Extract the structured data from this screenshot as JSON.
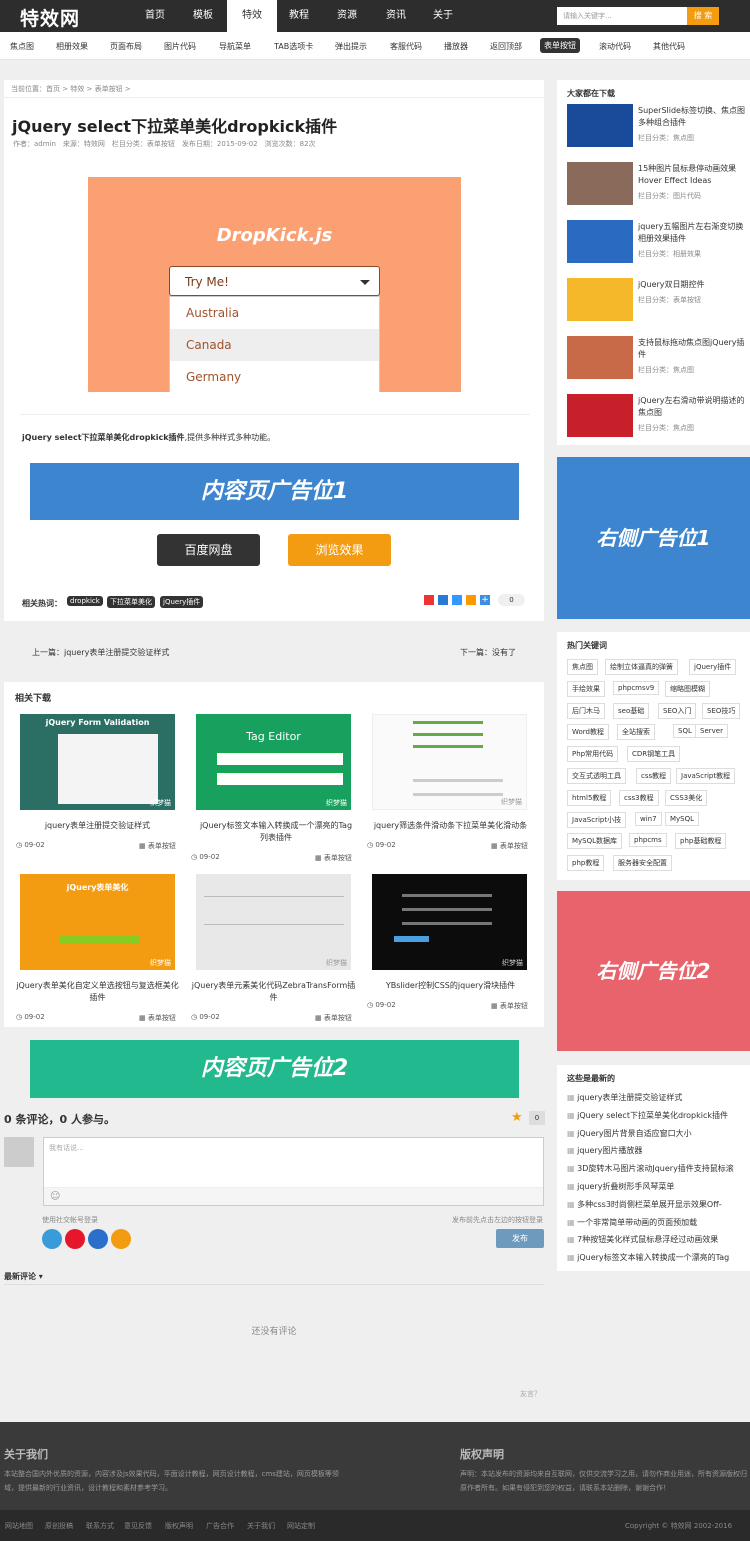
{
  "site": {
    "logo": "特效网"
  },
  "nav": {
    "items": [
      "首页",
      "模板",
      "特效",
      "教程",
      "资源",
      "资讯",
      "关于"
    ],
    "active": "特效"
  },
  "search": {
    "placeholder": "请输入关键字...",
    "button": "搜 索"
  },
  "subnav": {
    "items": [
      "焦点图",
      "相册效果",
      "页面布局",
      "图片代码",
      "导航菜单",
      "TAB选项卡",
      "弹出提示",
      "客服代码",
      "播放器",
      "返回顶部",
      "表单按钮",
      "滚动代码",
      "其他代码"
    ],
    "active": "表单按钮"
  },
  "article": {
    "breadcrumb": "当前位置：首页 > 特效 > 表单按钮 >",
    "title": "jQuery select下拉菜单美化dropkick插件",
    "meta": "作者：admin　来源：特效网　栏目分类：表单按钮　发布日期：2015-09-02　浏览次数：82次",
    "demo": {
      "title": "DropKick.js",
      "select": "Try Me!",
      "options": [
        "Australia",
        "Canada",
        "Germany"
      ]
    },
    "desc_bold": "jQuery select下拉菜单美化dropkick插件",
    "desc_rest": ",提供多种样式多种功能。",
    "ad1": "内容页广告位1",
    "btn_download": "百度网盘",
    "btn_view": "浏览效果",
    "tags_label": "相关热词：",
    "tags": [
      "dropkick",
      "下拉菜单美化",
      "jQuery插件"
    ],
    "share_count": "0"
  },
  "pager": {
    "prev": "上一篇：jquery表单注册提交验证样式",
    "next": "下一篇：没有了"
  },
  "related": {
    "title": "相关下载",
    "items": [
      {
        "caption": "jquery表单注册提交验证样式",
        "date": "09-02",
        "cat": "表单按钮",
        "thumb_title": "jQuery Form Validation"
      },
      {
        "caption": "jQuery标签文本输入转换成一个漂亮的Tag列表插件",
        "date": "09-02",
        "cat": "表单按钮",
        "thumb_title": "Tag Editor"
      },
      {
        "caption": "jquery筛选条件滑动条下拉菜单美化滑动条",
        "date": "09-02",
        "cat": "表单按钮",
        "thumb_title": ""
      },
      {
        "caption": "jQuery表单美化自定义单选按钮与复选框美化插件",
        "date": "09-02",
        "cat": "表单按钮",
        "thumb_title": "jQuery表单美化"
      },
      {
        "caption": "jQuery表单元素美化代码ZebraTransForm插件",
        "date": "09-02",
        "cat": "表单按钮",
        "thumb_title": ""
      },
      {
        "caption": "YBslider控制CSS的jquery滑块插件",
        "date": "09-02",
        "cat": "表单按钮",
        "thumb_title": ""
      }
    ],
    "watermark": "织梦猫"
  },
  "ad2": "内容页广告位2",
  "comments": {
    "count_line": "0 条评论，0 人参与。",
    "fav_count": "0",
    "placeholder": "我有话说...",
    "social_label": "使用社交帐号登录",
    "hint": "发布前先点击左边的按钮登录",
    "submit": "发布",
    "latest": "最新评论",
    "empty": "还没有评论",
    "powered": "友言？"
  },
  "sidebar": {
    "downloads_title": "大家都在下载",
    "downloads": [
      {
        "title": "SuperSlide标签切换、焦点图多种组合插件",
        "cat": "栏目分类：焦点图"
      },
      {
        "title": "15种图片鼠标悬停动画效果Hover Effect Ideas",
        "cat": "栏目分类：图片代码"
      },
      {
        "title": "jquery五幅图片左右渐变切换相册效果插件",
        "cat": "栏目分类：相册效果"
      },
      {
        "title": "jQuery双日期控件",
        "cat": "栏目分类：表单按钮"
      },
      {
        "title": "支持鼠标拖动焦点图jQuery插件",
        "cat": "栏目分类：焦点图"
      },
      {
        "title": "jQuery左右滑动带说明描述的焦点图",
        "cat": "栏目分类：焦点图"
      }
    ],
    "ad1": "右侧广告位1",
    "keywords_title": "热门关键词",
    "keywords": [
      "焦点图",
      "绘制立体逼真的弹簧",
      "jQuery插件",
      "手绘效果",
      "phpcmsv9",
      "缩略图模糊",
      "后门木马",
      "seo基础",
      "SEO入门",
      "SEO技巧",
      "Word教程",
      "全站搜索",
      "SQL",
      "Server",
      "Php常用代码",
      "CDR钢笔工具",
      "交互式透明工具",
      "css教程",
      "JavaScript教程",
      "html5教程",
      "css3教程",
      "CSS3美化",
      "JavaScript小技",
      "win7",
      "MySQL",
      "MySQL数据库",
      "phpcms",
      "php基础教程",
      "php教程",
      "服务器安全配置"
    ],
    "ad2": "右侧广告位2",
    "newest_title": "这些是最新的",
    "newest": [
      "jquery表单注册提交验证样式",
      "jQuery select下拉菜单美化dropkick插件",
      "jQuery图片背景自适应窗口大小",
      "jquery图片播放器",
      "3D旋转木马图片滚动Jquery插件支持鼠标滚",
      "jquery折叠树形手风琴菜单",
      "多种css3时尚侧栏菜单展开显示效果Off-",
      "一个非常简单带动画的页面预加载",
      "7种按钮美化样式鼠标悬浮经过动画效果",
      "jQuery标签文本输入转换成一个漂亮的Tag"
    ]
  },
  "footer": {
    "about_title": "关于我们",
    "about_text": "本站整合国内外优质的资源，内容涉及js效果代码，平面设计教程，网页设计教程，cms建站，网页模板等领域，提供最新的行业资讯，设计教程和素材参考学习。",
    "copyright_title": "版权声明",
    "copyright_text": "声明：本站发布的资源均来自互联网，仅供交流学习之用，请勿作商业用途，所有资源版权归原作者所有。如果有侵犯到您的权益，请联系本站删除，谢谢合作！",
    "links": [
      "网站地图",
      "原创投稿",
      "联系方式",
      "意见反馈",
      "版权声明",
      "广告合作",
      "关于我们",
      "网站定制"
    ],
    "copyright": "Copyright © 特效网 2002-2016"
  },
  "colors": {
    "accent": "#f39c12",
    "ad_blue": "#3d86cf",
    "ad_green": "#22b98e",
    "ad_red": "#e8636b",
    "dark": "#2d2d2d"
  }
}
